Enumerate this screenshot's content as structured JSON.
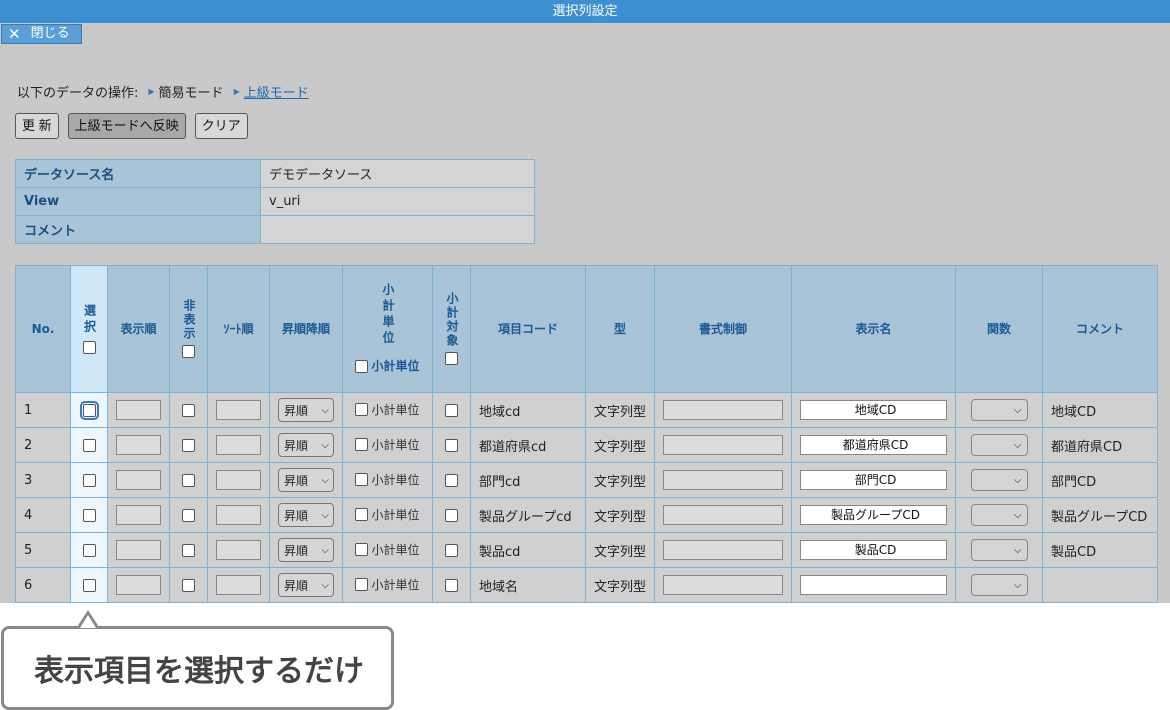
{
  "window": {
    "title": "選択列設定",
    "close_label": "閉じる"
  },
  "ops": {
    "label": "以下のデータの操作:",
    "simple_mode": "簡易モード",
    "advanced_mode": "上級モード"
  },
  "buttons": {
    "update": "更 新",
    "apply_advanced": "上級モードへ反映",
    "clear": "クリア"
  },
  "info": [
    {
      "key": "データソース名",
      "value": "デモデータソース"
    },
    {
      "key": "View",
      "value": "v_uri"
    },
    {
      "key": "コメント",
      "value": ""
    }
  ],
  "columns": {
    "no": "No.",
    "select": "選択",
    "display_order": "表示順",
    "hidden": "非表示",
    "sort_order": "ｿｰﾄ順",
    "asc_desc": "昇順降順",
    "subtotal_unit": "小計単位",
    "subtotal_target": "小計対象",
    "item_code": "項目コード",
    "type": "型",
    "format": "書式制御",
    "display_name": "表示名",
    "function": "関数",
    "comment": "コメント"
  },
  "rows": [
    {
      "no": "1",
      "order": "昇順",
      "subtotal": "小計単位",
      "code": "地域cd",
      "type": "文字列型",
      "display_name": "地域CD",
      "comment": "地域CD"
    },
    {
      "no": "2",
      "order": "昇順",
      "subtotal": "小計単位",
      "code": "都道府県cd",
      "type": "文字列型",
      "display_name": "都道府県CD",
      "comment": "都道府県CD"
    },
    {
      "no": "3",
      "order": "昇順",
      "subtotal": "小計単位",
      "code": "部門cd",
      "type": "文字列型",
      "display_name": "部門CD",
      "comment": "部門CD"
    },
    {
      "no": "4",
      "order": "昇順",
      "subtotal": "小計単位",
      "code": "製品グループcd",
      "type": "文字列型",
      "display_name": "製品グループCD",
      "comment": "製品グループCD"
    },
    {
      "no": "5",
      "order": "昇順",
      "subtotal": "小計単位",
      "code": "製品cd",
      "type": "文字列型",
      "display_name": "製品CD",
      "comment": "製品CD"
    },
    {
      "no": "6",
      "order": "昇順",
      "subtotal": "小計単位",
      "code": "地域名",
      "type": "文字列型",
      "display_name": "",
      "comment": ""
    }
  ],
  "callout": {
    "text": "表示項目を選択するだけ"
  },
  "colors": {
    "titlebar": "#3c8fd0",
    "header": "#a9c4d6",
    "border": "#7fb3d6",
    "link": "#1a6bb8"
  }
}
